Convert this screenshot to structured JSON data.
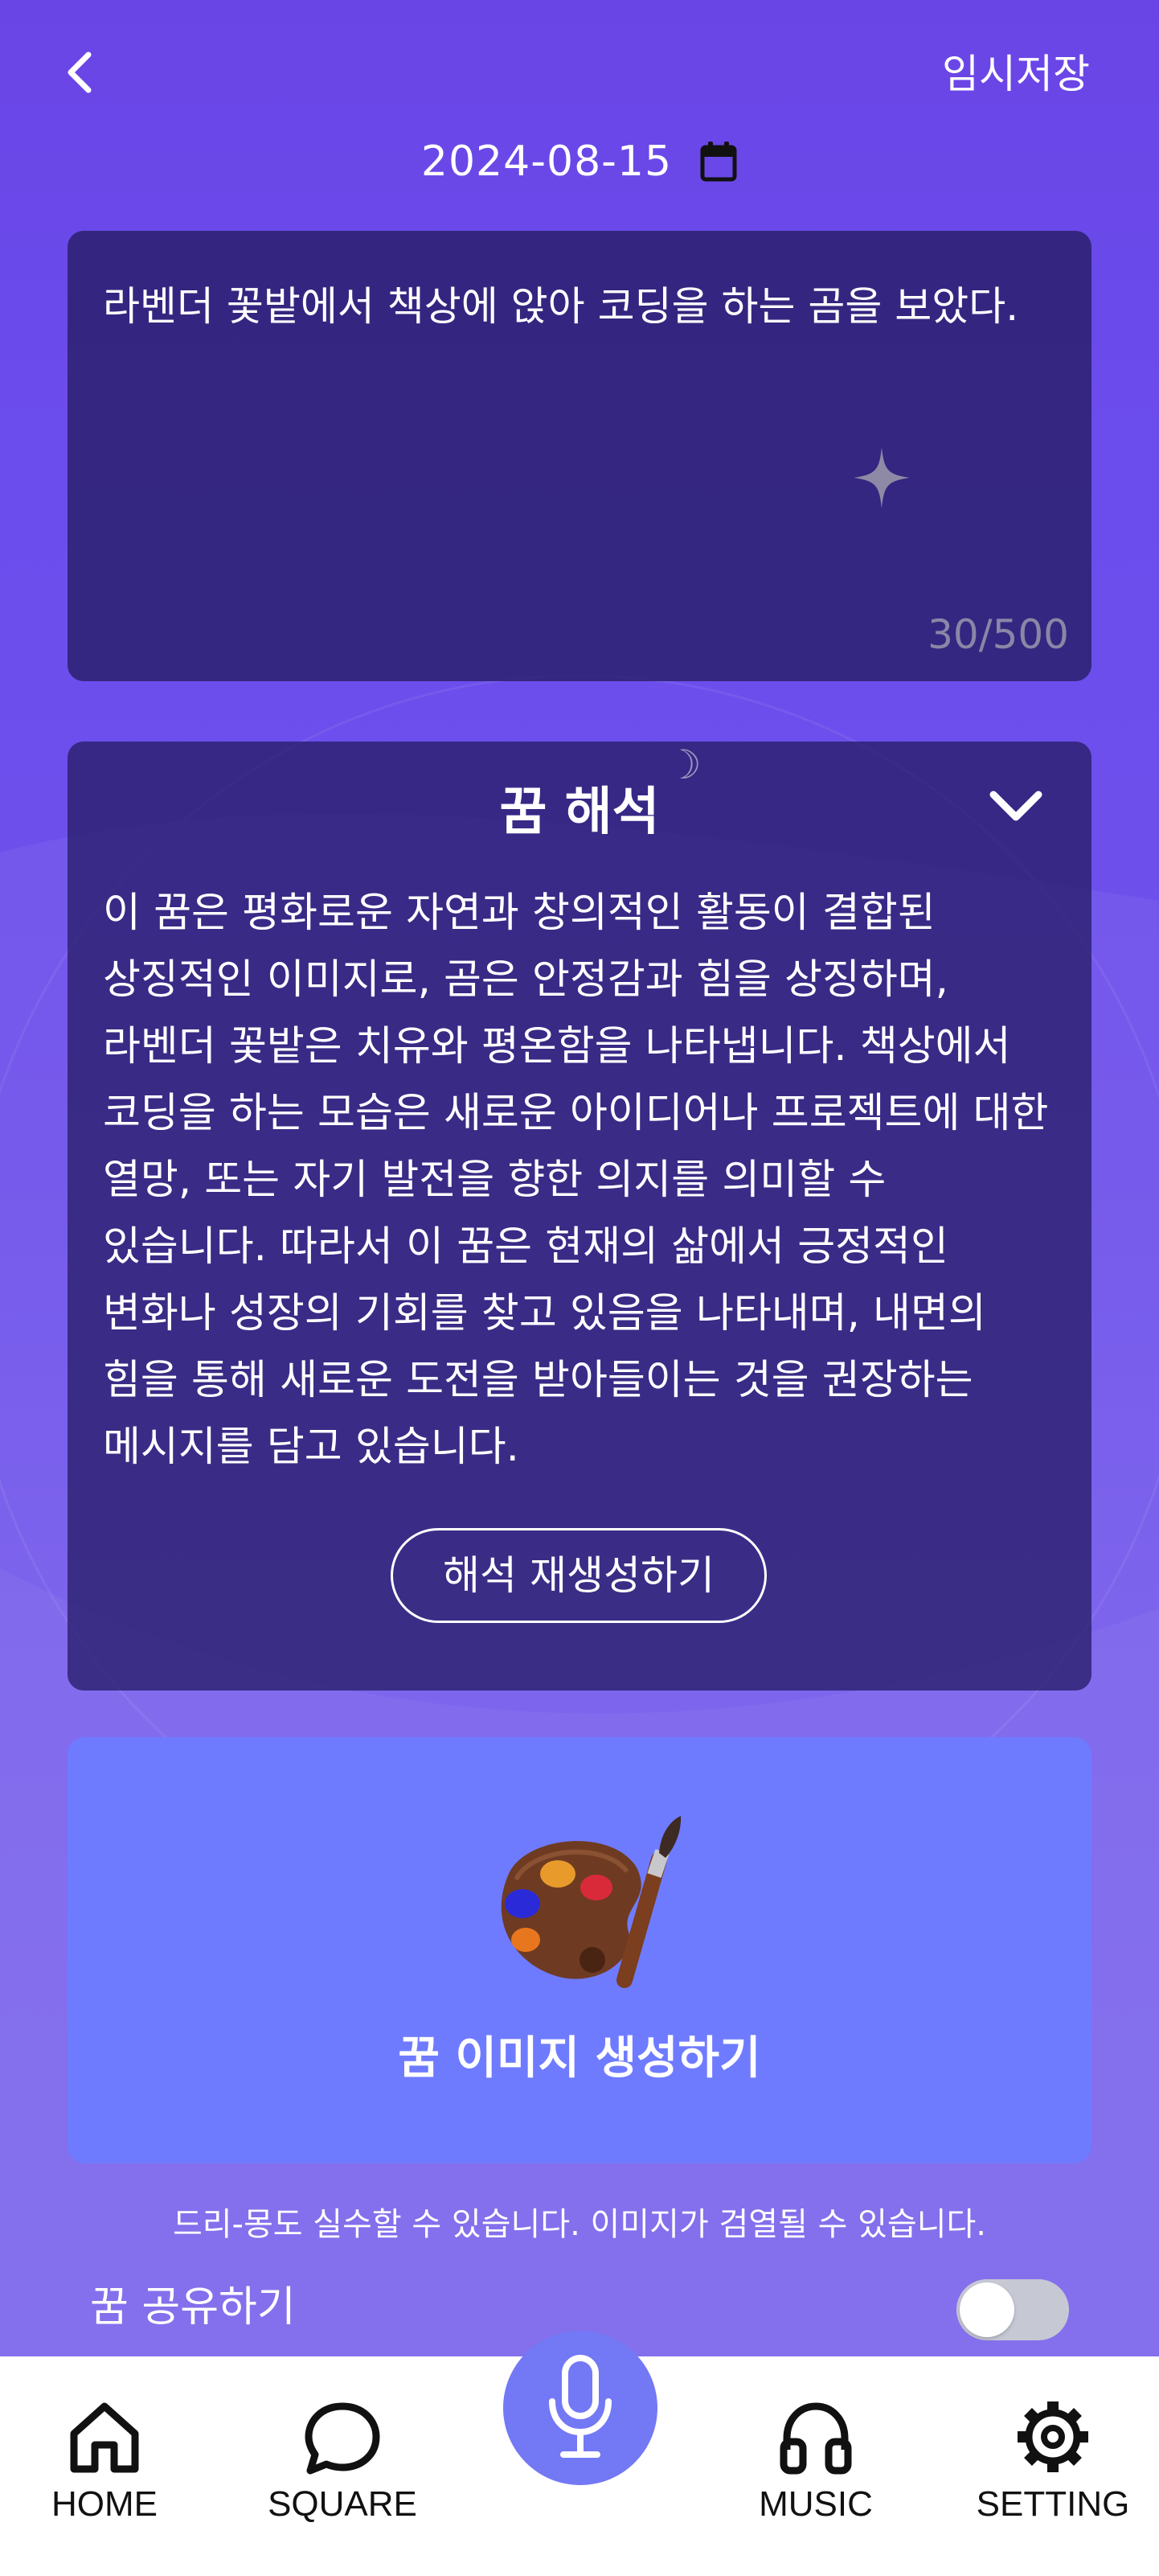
{
  "header": {
    "back_icon": "chevron-left-icon",
    "save_draft_label": "임시저장",
    "date": "2024-08-15",
    "calendar_icon": "calendar-icon"
  },
  "dream_input": {
    "text": "라벤더 꽃밭에서 책상에 앉아 코딩을 하는 곰을 보았다.",
    "char_count": "30/500",
    "decor_icon": "sparkle-icon"
  },
  "interpretation": {
    "title": "꿈 해석",
    "toggle_icon": "chevron-down-icon",
    "body": "이 꿈은 평화로운 자연과 창의적인 활동이 결합된 상징적인 이미지로, 곰은 안정감과 힘을 상징하며, 라벤더 꽃밭은 치유와 평온함을 나타냅니다. 책상에서 코딩을 하는 모습은 새로운 아이디어나 프로젝트에 대한 열망, 또는 자기 발전을 향한 의지를 의미할 수 있습니다. 따라서 이 꿈은 현재의 삶에서 긍정적인 변화나 성장의 기회를 찾고 있음을 나타내며, 내면의 힘을 통해 새로운 도전을 받아들이는 것을 권장하는 메시지를 담고 있습니다.",
    "regenerate_label": "해석 재생성하기"
  },
  "image_generation": {
    "icon": "palette-icon",
    "label": "꿈 이미지 생성하기"
  },
  "disclaimer": "드리-몽도 실수할 수 있습니다. 이미지가 검열될 수 있습니다.",
  "share": {
    "label": "꿈 공유하기",
    "enabled": false
  },
  "bottom_nav": {
    "items": [
      {
        "label": "HOME",
        "icon": "home-icon"
      },
      {
        "label": "SQUARE",
        "icon": "chat-bubble-icon"
      },
      {
        "label": "MUSIC",
        "icon": "headphones-icon"
      },
      {
        "label": "SETTING",
        "icon": "gear-icon"
      }
    ],
    "center_icon": "microphone-icon"
  },
  "colors": {
    "background_top": "#6a45e6",
    "background_bottom": "#7a66eb",
    "card_dark": "#2a1f69",
    "image_card": "#6f7bff",
    "mic_button": "#7378f5",
    "toggle_off": "#c6c8d4"
  }
}
